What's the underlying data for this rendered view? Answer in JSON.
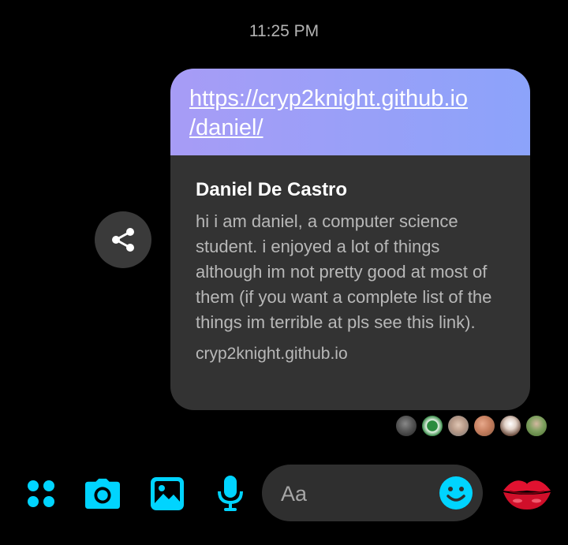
{
  "timestamp": "11:25 PM",
  "message": {
    "link_text_line1": "https://cryp2knight.github.io",
    "link_text_line2": "/daniel/",
    "preview_title": "Daniel De Castro",
    "preview_description": "hi i am daniel, a computer science student. i enjoyed a lot of things although im not pretty good at most of them (if you want a complete list of the things im terrible at pls see this link).",
    "preview_domain": "cryp2knight.github.io"
  },
  "composer": {
    "placeholder": "Aa"
  },
  "icons": {
    "share": "share-icon",
    "menu": "four-dots-icon",
    "camera": "camera-icon",
    "gallery": "image-icon",
    "mic": "microphone-icon",
    "emoji": "smiley-icon",
    "quick_reaction": "lips-icon"
  },
  "colors": {
    "accent": "#00d4ff",
    "link_gradient_start": "#a79cf6",
    "link_gradient_end": "#8ca3fa",
    "bubble_bg": "#333333",
    "input_bg": "#2f2f2f"
  }
}
